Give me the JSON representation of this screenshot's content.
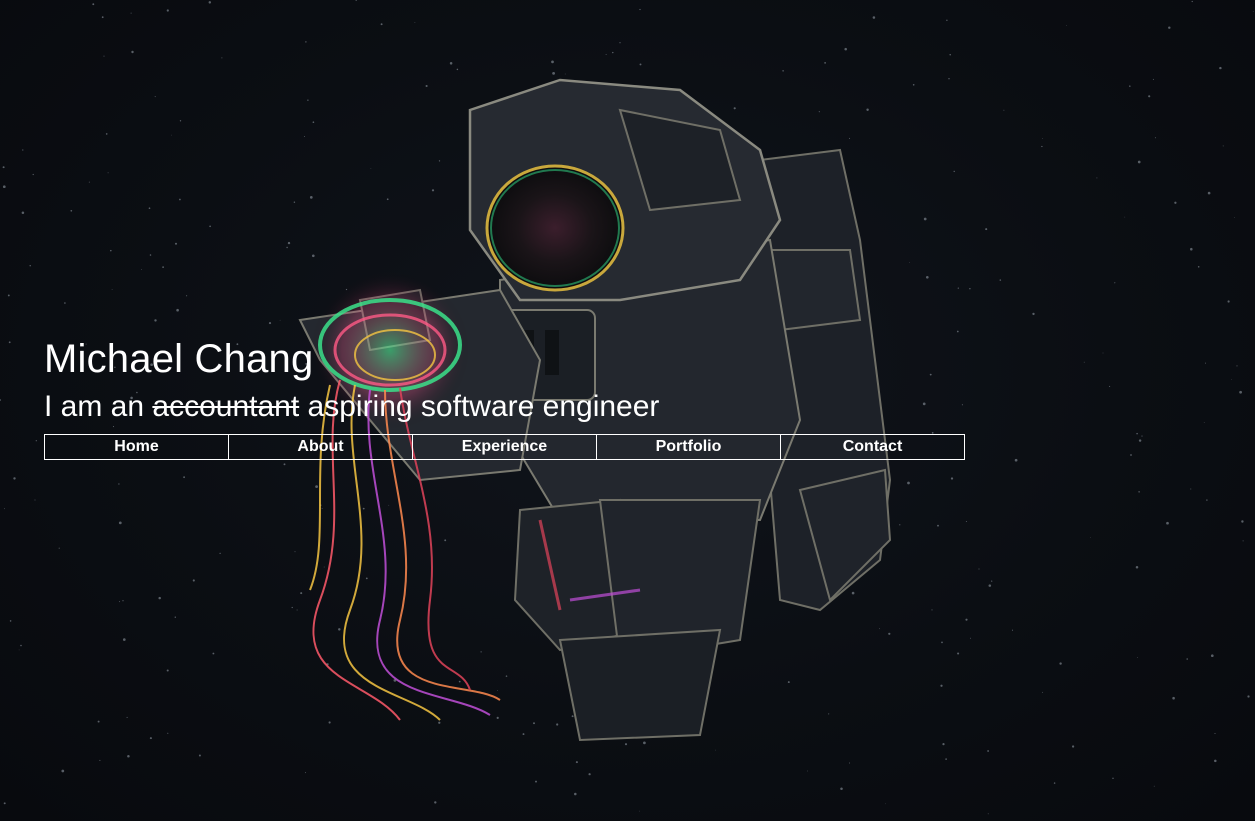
{
  "hero": {
    "name": "Michael Chang",
    "tagline_prefix": "I am an",
    "tagline_struck": "accountant",
    "tagline_suffix": "aspiring software engineer"
  },
  "nav": {
    "items": [
      {
        "label": "Home"
      },
      {
        "label": "About"
      },
      {
        "label": "Experience"
      },
      {
        "label": "Portfolio"
      },
      {
        "label": "Contact"
      }
    ]
  },
  "background": {
    "image": "astronaut-with-jellyfish-illustration",
    "colors": {
      "sky": "#0a0d12",
      "suit": "#262b33",
      "suit_shadow": "#15191f",
      "outline": "#8a8a80",
      "jelly_green": "#25d07a",
      "jelly_pink": "#ff4f8b",
      "jelly_yellow": "#f5c542",
      "jelly_purple": "#b04fd8"
    }
  }
}
